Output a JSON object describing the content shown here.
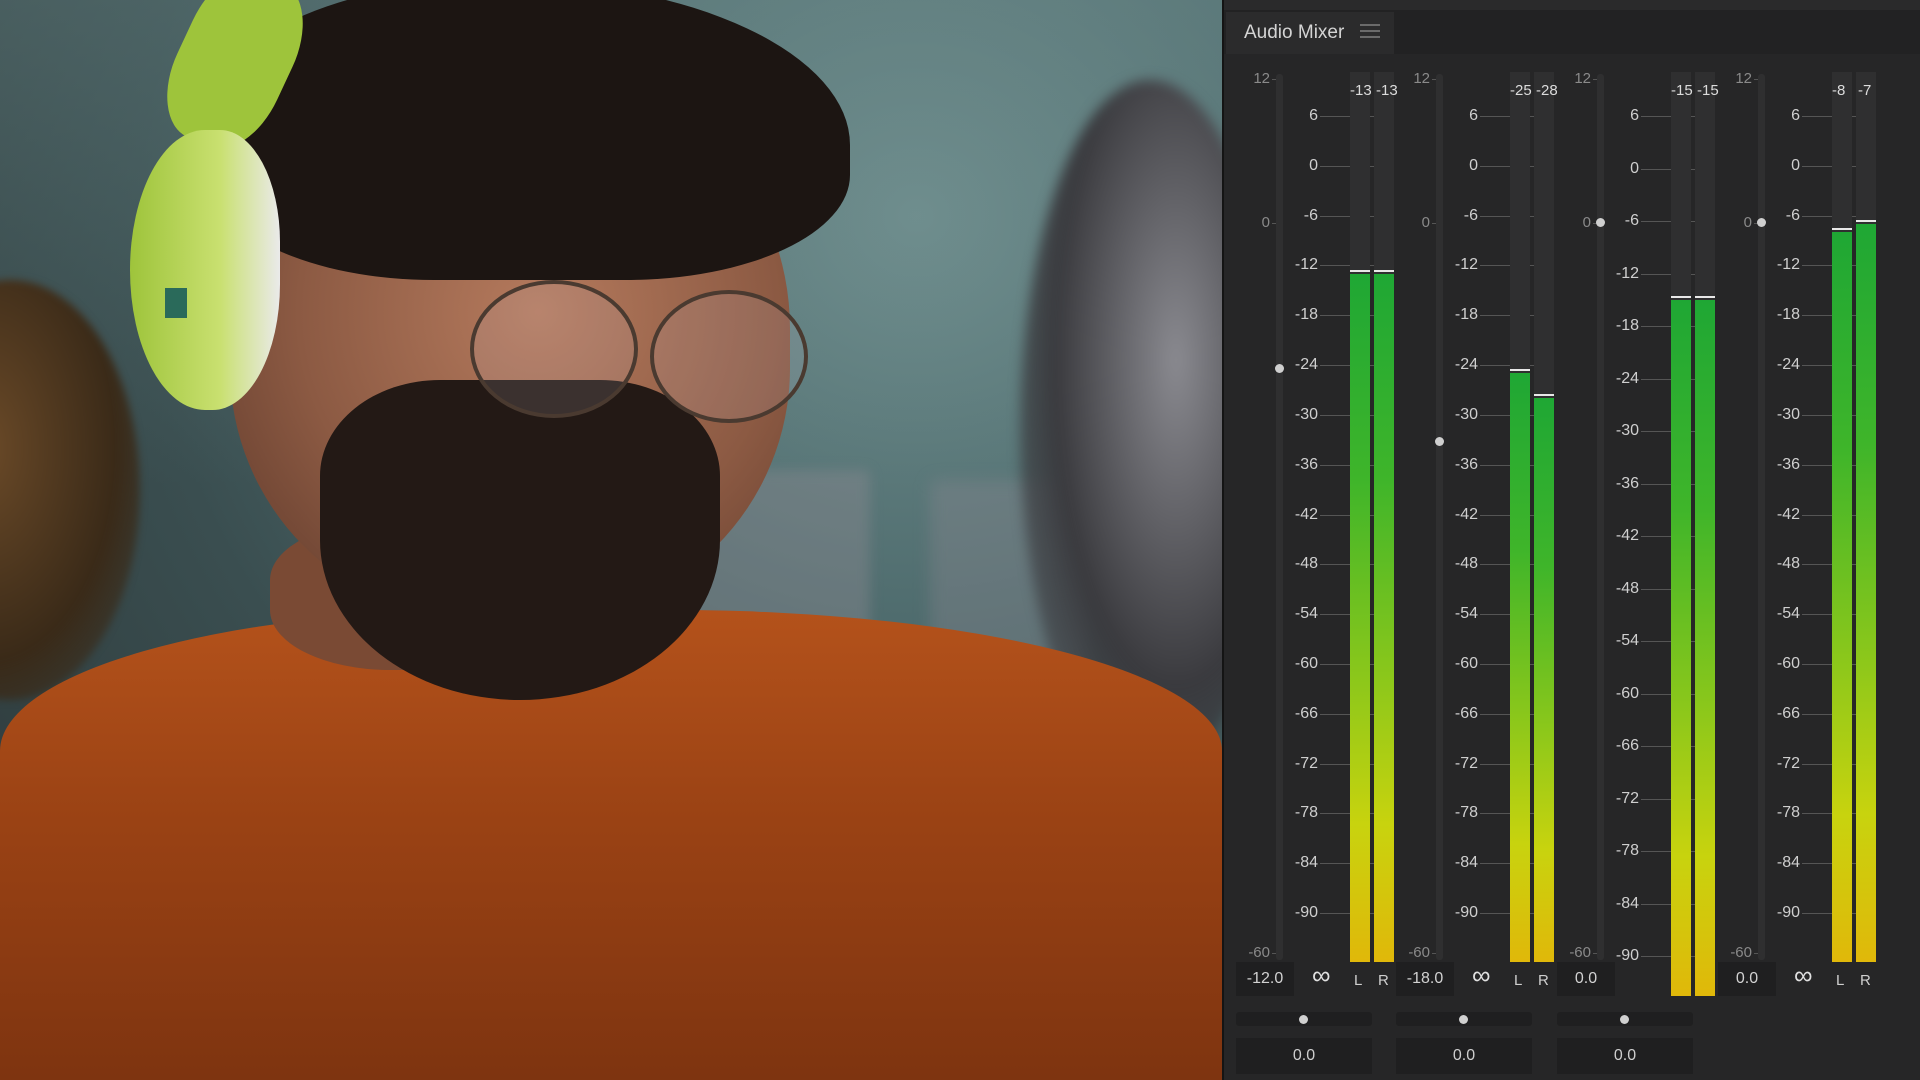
{
  "panel": {
    "title": "Audio Mixer",
    "menu_icon": "hamburger-menu-icon"
  },
  "fader_scale": [
    "12",
    "0",
    "-60"
  ],
  "meter_scale_default": [
    "6",
    "0",
    "-6",
    "-12",
    "-18",
    "-24",
    "-30",
    "-36",
    "-42",
    "-48",
    "-54",
    "-60",
    "-66",
    "-72",
    "-78",
    "-84",
    "-90"
  ],
  "meter_scale_track3": [
    "6",
    "0",
    "-6",
    "-12",
    "-18",
    "-24",
    "-30",
    "-36",
    "-42",
    "-48",
    "-54",
    "-60",
    "-66",
    "-72",
    "-78",
    "-84",
    "-90"
  ],
  "colors": {
    "meter_top": "#1fa734",
    "meter_bottom": "#e0b80a",
    "panel_bg": "#262627"
  },
  "tracks": [
    {
      "peak_l": "-13",
      "peak_r": "-13",
      "level_l": -13,
      "level_r": -13,
      "fader_db": -12.0,
      "gain": "-12.0",
      "show_lr": true,
      "show_inf": true,
      "L": "L",
      "R": "R",
      "pan": "0.0",
      "pan_pos": 0.5,
      "inf": "∞"
    },
    {
      "peak_l": "-25",
      "peak_r": "-28",
      "level_l": -25,
      "level_r": -28,
      "fader_db": -18.0,
      "gain": "-18.0",
      "show_lr": true,
      "show_inf": true,
      "L": "L",
      "R": "R",
      "pan": "0.0",
      "pan_pos": 0.5,
      "inf": "∞"
    },
    {
      "peak_l": "-15",
      "peak_r": "-15",
      "level_l": -15,
      "level_r": -15,
      "fader_db": 0.0,
      "gain": "0.0",
      "show_lr": false,
      "show_inf": false,
      "L": "",
      "R": "",
      "pan": "0.0",
      "pan_pos": 0.5,
      "inf": ""
    },
    {
      "peak_l": "-8",
      "peak_r": "-7",
      "level_l": -8,
      "level_r": -7,
      "fader_db": 0.0,
      "gain": "0.0",
      "show_lr": true,
      "show_inf": true,
      "L": "L",
      "R": "R",
      "pan": "",
      "pan_pos": null,
      "inf": "∞"
    }
  ]
}
